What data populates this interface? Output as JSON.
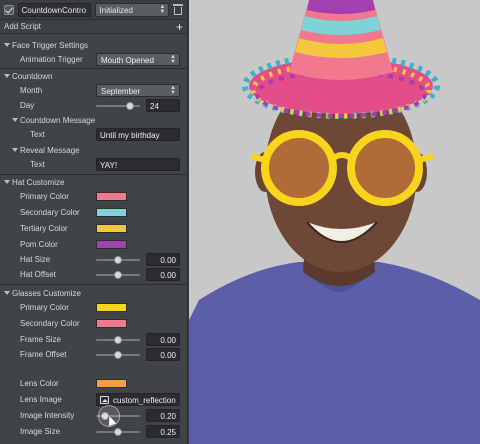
{
  "header": {
    "script_name": "CountdownContro",
    "status": "Initialized",
    "add_script": "Add Script",
    "add_icon": "plus-icon"
  },
  "face_trigger": {
    "title": "Face Trigger Settings",
    "trigger_label": "Animation Trigger",
    "trigger_value": "Mouth Opened"
  },
  "countdown": {
    "title": "Countdown",
    "month_label": "Month",
    "month_value": "September",
    "day_label": "Day",
    "day_value": "24",
    "day_level": 0.78,
    "message_title": "Countdown Message",
    "message_label": "Text",
    "message_value": "Until my birthday",
    "reveal_title": "Reveal Message",
    "reveal_label": "Text",
    "reveal_value": "YAY!"
  },
  "hat": {
    "title": "Hat Customize",
    "primary_label": "Primary Color",
    "primary_color": "#f2788f",
    "secondary_label": "Secondary Color",
    "secondary_color": "#7fd3d6",
    "tertiary_label": "Tertiary Color",
    "tertiary_color": "#f3c83d",
    "pom_label": "Pom Color",
    "pom_color": "#a43fb2",
    "size_label": "Hat Size",
    "size_value": "0.00",
    "size_level": 0.5,
    "offset_label": "Hat Offset",
    "offset_value": "0.00",
    "offset_level": 0.5
  },
  "glasses": {
    "title": "Glasses Customize",
    "primary_label": "Primary Color",
    "primary_color": "#f8d41d",
    "secondary_label": "Secondary Color",
    "secondary_color": "#f2788f",
    "frame_size_label": "Frame Size",
    "frame_size_value": "0.00",
    "frame_size_level": 0.5,
    "frame_offset_label": "Frame Offset",
    "frame_offset_value": "0.00",
    "frame_offset_level": 0.5,
    "lens_color_label": "Lens Color",
    "lens_color": "#f2a23a",
    "lens_image_label": "Lens Image",
    "lens_image_value": "custom_reflection",
    "intensity_label": "Image Intensity",
    "intensity_value": "0.20",
    "intensity_level": 0.2,
    "image_size_label": "Image Size",
    "image_size_value": "0.25",
    "image_size_level": 0.5
  }
}
